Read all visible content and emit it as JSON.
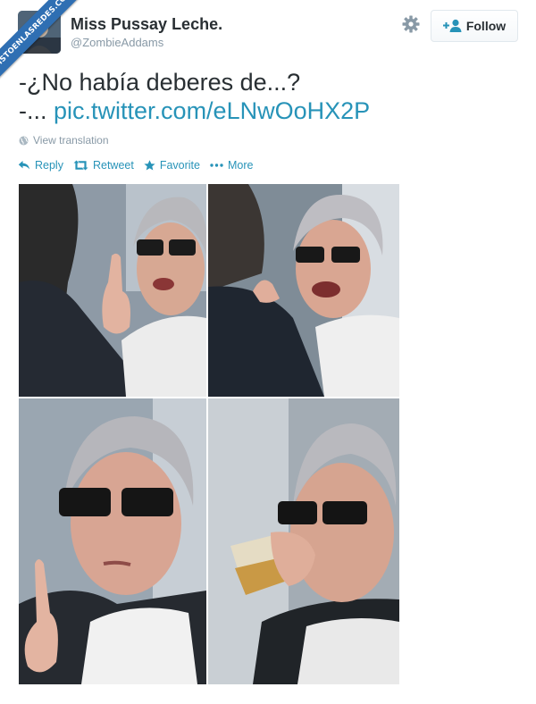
{
  "watermark": "VISTOENLASREDES.COM",
  "user": {
    "display_name": "Miss Pussay Leche.",
    "handle": "@ZombieAddams"
  },
  "header": {
    "settings_icon": "gear-icon",
    "follow_label": "Follow"
  },
  "tweet": {
    "line1": "-¿No había deberes de...?",
    "line2_prefix": "-...",
    "link_text": "pic.twitter.com/eLNwOoHX2P"
  },
  "translation": {
    "label": "View translation"
  },
  "actions": {
    "reply": "Reply",
    "retweet": "Retweet",
    "favorite": "Favorite",
    "more": "More"
  },
  "colors": {
    "link": "#2793b8",
    "text": "#292f33",
    "muted": "#8899a6"
  },
  "photos": [
    {
      "alt": "woman-with-glasses-raising-finger"
    },
    {
      "alt": "woman-with-glasses-shouting"
    },
    {
      "alt": "woman-with-glasses-pointing-finger"
    },
    {
      "alt": "woman-with-glasses-drinking"
    }
  ]
}
